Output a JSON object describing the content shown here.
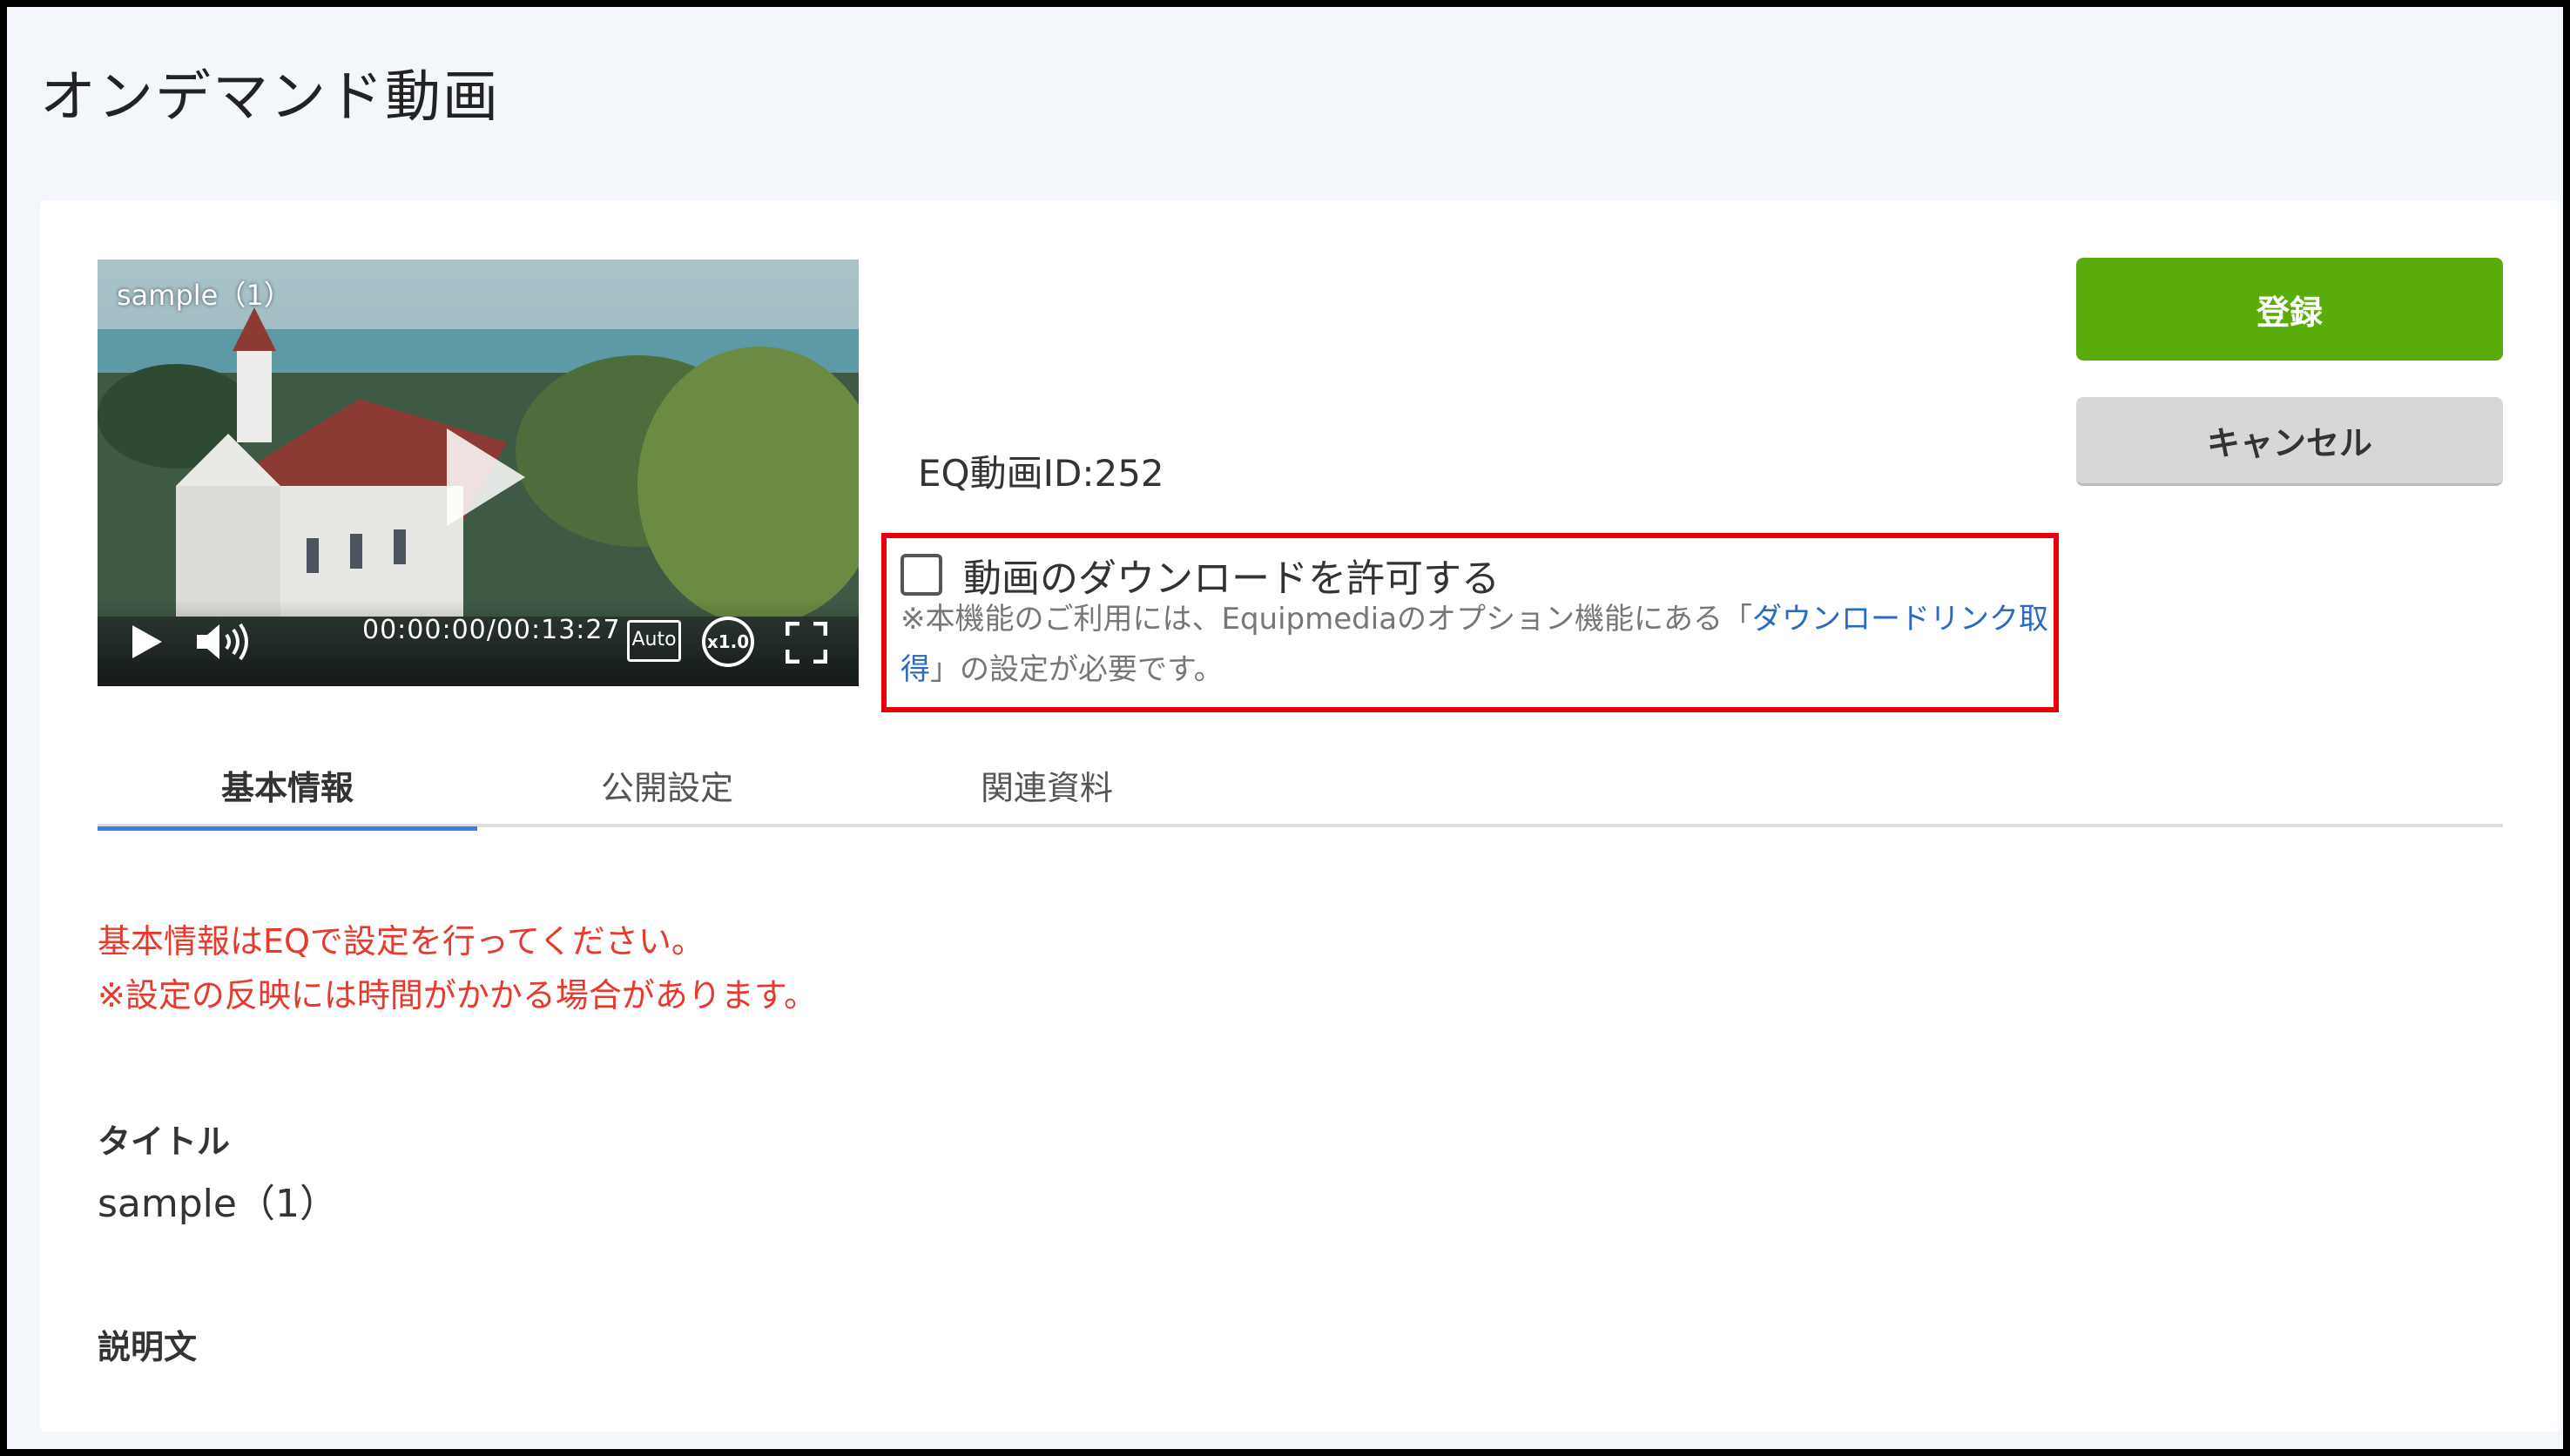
{
  "page": {
    "title": "オンデマンド動画"
  },
  "player": {
    "title": "sample（1）",
    "time": "00:00:00/00:13:27",
    "quality_label": "Auto",
    "speed_label": "x1.0"
  },
  "video": {
    "eq_id_label": "EQ動画ID:252"
  },
  "download": {
    "checkbox_label": "動画のダウンロードを許可する",
    "checked": false,
    "note_prefix": "※本機能のご利用には、Equipmediaのオプション機能にある「",
    "note_link": "ダウンロードリンク取得",
    "note_suffix": "」の設定が必要です。"
  },
  "buttons": {
    "register": "登録",
    "cancel": "キャンセル"
  },
  "tabs": [
    {
      "label": "基本情報",
      "active": true
    },
    {
      "label": "公開設定",
      "active": false
    },
    {
      "label": "関連資料",
      "active": false
    }
  ],
  "messages": {
    "line1": "基本情報はEQで設定を行ってください。",
    "line2": "※設定の反映には時間がかかる場合があります。"
  },
  "fields": {
    "title_label": "タイトル",
    "title_value": "sample（1）",
    "description_label": "説明文"
  },
  "colors": {
    "accent_green": "#5aac0b",
    "highlight_red": "#e8000c",
    "link_blue": "#2a69c4",
    "tab_active": "#3a7fe0",
    "warning_red": "#e8392d"
  }
}
